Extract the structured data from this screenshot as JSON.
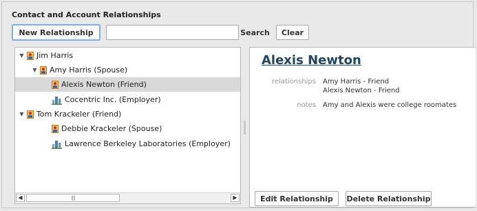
{
  "header": {
    "title": "Contact and Account Relationships"
  },
  "toolbar": {
    "new_label": "New Relationship",
    "search_value": "",
    "search_label": "Search",
    "clear_label": "Clear"
  },
  "tree": {
    "items": [
      {
        "label": "Jim Harris",
        "icon": "person-icon",
        "expanded": true
      },
      {
        "label": "Amy Harris (Spouse)",
        "icon": "person-icon",
        "expanded": true
      },
      {
        "label": "Alexis Newton (Friend)",
        "icon": "person-icon",
        "selected": true
      },
      {
        "label": "Cocentric Inc. (Employer)",
        "icon": "building-icon"
      },
      {
        "label": "Tom Krackeler (Friend)",
        "icon": "person-icon",
        "expanded": true
      },
      {
        "label": "Debbie Krackeler (Spouse)",
        "icon": "person-icon"
      },
      {
        "label": "Lawrence Berkeley Laboratories (Employer)",
        "icon": "building-icon"
      }
    ]
  },
  "detail": {
    "name": "Alexis Newton",
    "relationships_label": "relationships",
    "relationships": [
      "Amy Harris - Friend",
      "Alexis Newton - Friend"
    ],
    "notes_label": "notes",
    "notes": "Amy and Alexis were college roomates",
    "edit_label": "Edit Relationship",
    "delete_label": "Delete Relationship"
  },
  "colors": {
    "accent": "#7fb0df",
    "title_link": "#21465f",
    "selection": "#d9d9d9"
  }
}
